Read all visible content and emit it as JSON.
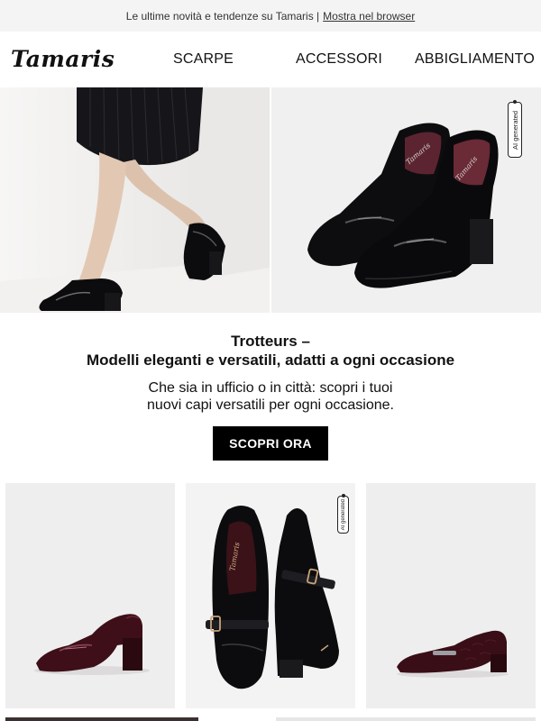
{
  "preheader": {
    "text": "Le ultime novità e tendenze su Tamaris |",
    "link_label": "Mostra nel browser"
  },
  "brand": {
    "logo_text": "Tamaris"
  },
  "nav": {
    "items": [
      {
        "label": "SCARPE"
      },
      {
        "label": "ACCESSORI"
      },
      {
        "label": "ABBIGLIAMENTO"
      }
    ]
  },
  "hero": {
    "left_image": "model-legs-wearing-black-patent-loafers-icon",
    "right_image": "pair-black-patent-heeled-loafers-icon",
    "ai_badge": "AI generated",
    "shoe_brand_print": "Tamaris"
  },
  "content": {
    "headline_line1": "Trotteurs –",
    "headline_line2": "Modelli eleganti e versatili, adatti a ogni occasione",
    "body_line1": "Che sia in ufficio o in città: scopri i tuoi",
    "body_line2": "nuovi capi versatili per ogni occasione.",
    "cta_label": "SCOPRI ORA"
  },
  "products": [
    {
      "image": "burgundy-block-heel-loafer-icon"
    },
    {
      "image": "black-buckle-loafers-pair-icon",
      "ai_badge": "AI generated",
      "shoe_brand_print": "Tamaris"
    },
    {
      "image": "burgundy-croc-low-heel-loafer-icon"
    }
  ],
  "colors": {
    "accent": "#000000",
    "preheader_bg": "#f4f4f4",
    "burgundy": "#4a1420",
    "patent_black": "#0e0e10"
  }
}
